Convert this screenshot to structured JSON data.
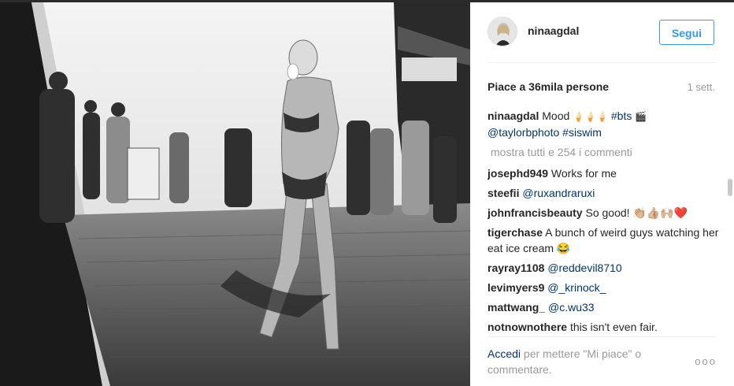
{
  "post": {
    "username": "ninaagdal",
    "follow_label": "Segui",
    "likes_text": "Piace a 36mila persone",
    "time_ago": "1 sett.",
    "caption": {
      "author": "ninaagdal",
      "text_start": "Mood ",
      "emojis": "🍦🍦🍦",
      "hashtag_bts": "#bts",
      "emoji_end": "🎬",
      "mention": "@taylorbphoto",
      "hashtag_siswim": "#siswim"
    },
    "view_all": "mostra tutti e 254 i commenti",
    "comments": [
      {
        "author": "josephd949",
        "text": "Works for me"
      },
      {
        "author": "steefii",
        "text": "@ruxandraruxi"
      },
      {
        "author": "johnfrancisbeauty",
        "text": "So good! 👏🏼👍🏼🙌🏼❤️"
      },
      {
        "author": "tigerchase",
        "text": "A bunch of weird guys watching her eat ice cream 😂"
      },
      {
        "author": "rayray1108",
        "text": "@reddevil8710"
      },
      {
        "author": "levimyers9",
        "text": "@_krinock_"
      },
      {
        "author": "mattwang_",
        "text": "@c.wu33"
      },
      {
        "author": "notnownothere",
        "text": "this isn't even fair."
      }
    ],
    "footer": {
      "login_link": "Accedi",
      "login_text": " per mettere \"Mi piace\" o commentare.",
      "options": "ooo"
    }
  }
}
